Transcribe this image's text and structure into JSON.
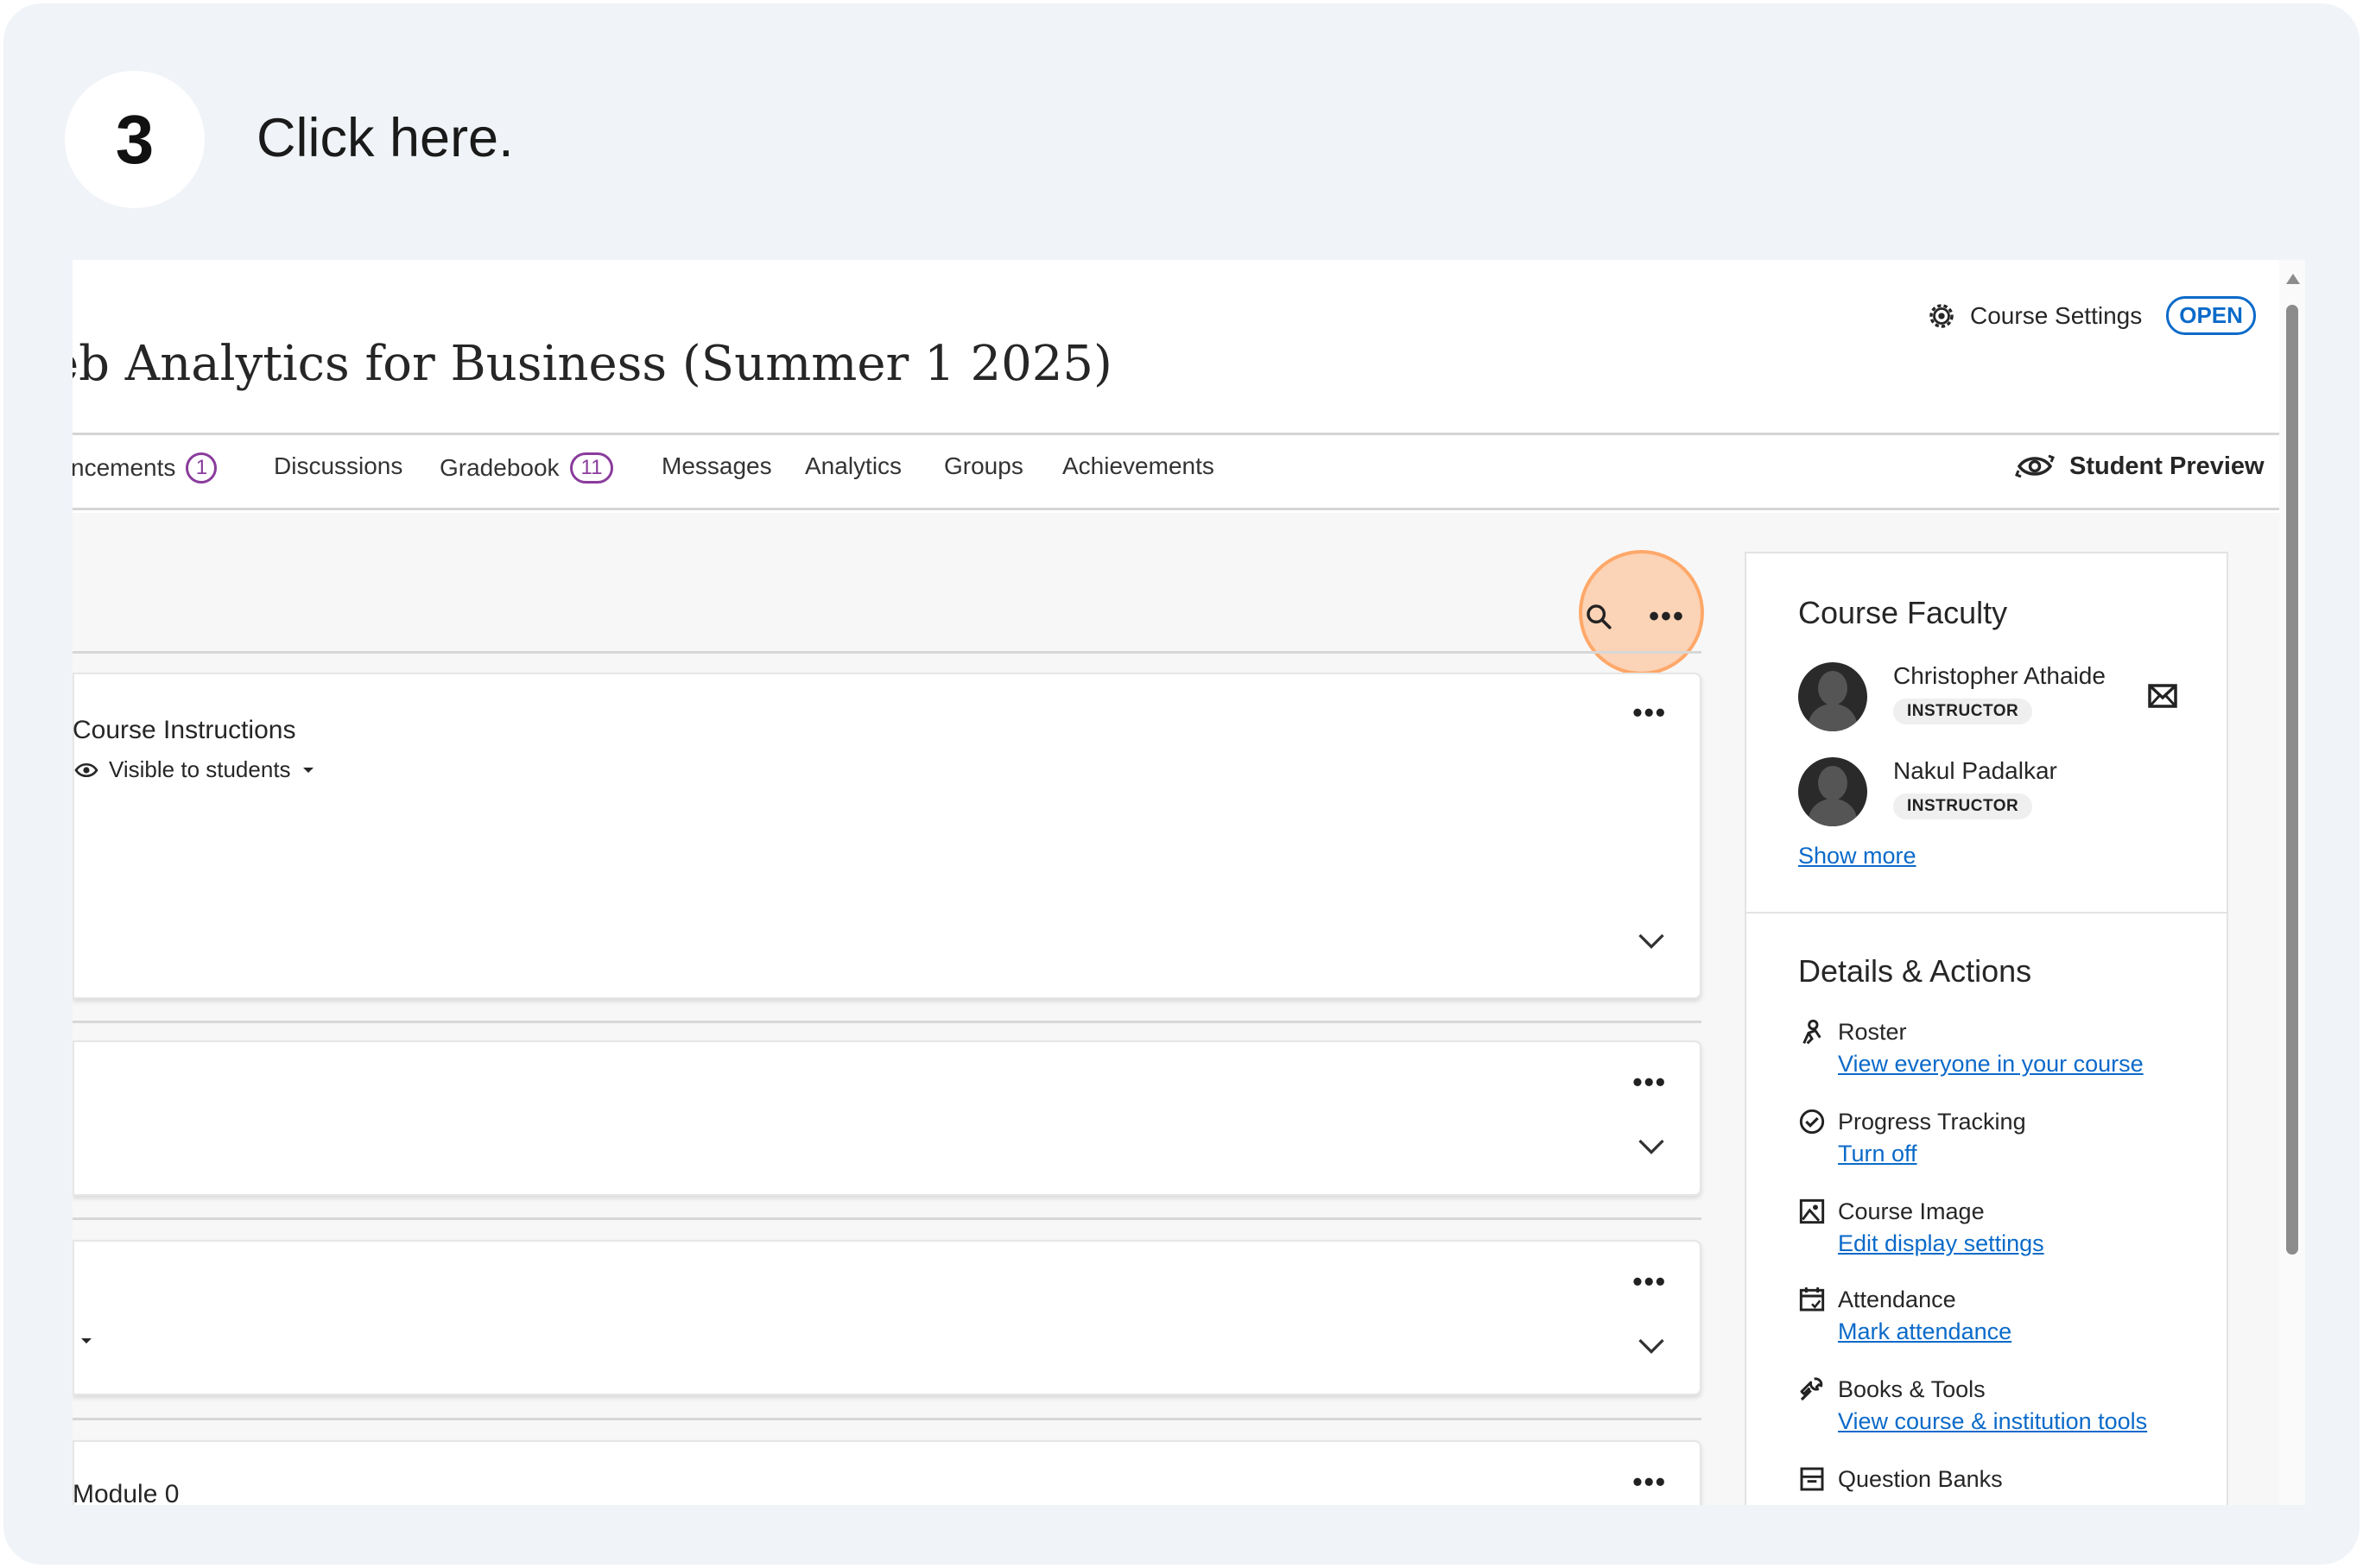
{
  "step": {
    "number": "3",
    "instruction": "Click here."
  },
  "course": {
    "title": "eb Analytics for Business (Summer 1 2025)",
    "settings_label": "Course Settings",
    "status_badge": "OPEN"
  },
  "nav": {
    "items": [
      {
        "label": "ncements",
        "count": "1"
      },
      {
        "label": "Discussions"
      },
      {
        "label": "Gradebook",
        "count": "11"
      },
      {
        "label": "Messages"
      },
      {
        "label": "Analytics"
      },
      {
        "label": "Groups"
      },
      {
        "label": "Achievements"
      }
    ],
    "student_preview": "Student Preview"
  },
  "toolbar": {
    "search_icon": "search-icon",
    "more_icon": "more-options-icon",
    "more_glyph": "•••"
  },
  "content": {
    "cards": [
      {
        "title": "Course Instructions",
        "visibility": "Visible to students"
      },
      {
        "title": ""
      },
      {
        "title": ""
      },
      {
        "title": "Module 0"
      }
    ]
  },
  "sidebar": {
    "faculty_heading": "Course Faculty",
    "faculty": [
      {
        "name": "Christopher Athaide",
        "role": "INSTRUCTOR"
      },
      {
        "name": "Nakul Padalkar",
        "role": "INSTRUCTOR"
      }
    ],
    "show_more": "Show more",
    "details_heading": "Details & Actions",
    "actions": [
      {
        "label": "Roster",
        "link": "View everyone in your course",
        "icon": "roster-icon"
      },
      {
        "label": "Progress Tracking",
        "link": "Turn off",
        "icon": "check-circle-icon"
      },
      {
        "label": "Course Image",
        "link": "Edit display settings",
        "icon": "image-icon"
      },
      {
        "label": "Attendance",
        "link": "Mark attendance",
        "icon": "calendar-icon"
      },
      {
        "label": "Books & Tools",
        "link": "View course & institution tools",
        "icon": "wrench-icon"
      },
      {
        "label": "Question Banks",
        "link": "",
        "icon": "bank-icon"
      }
    ]
  },
  "colors": {
    "accent": "#0b6ac9",
    "badge_purple": "#8a3c9c",
    "highlight": "#ffa666"
  }
}
